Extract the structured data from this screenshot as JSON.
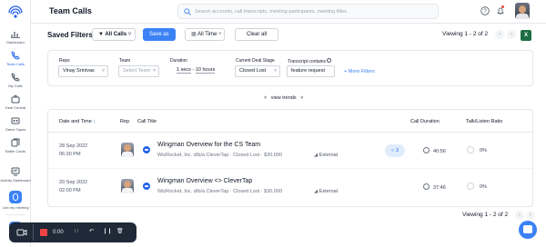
{
  "app": {
    "page_title": "Team Calls"
  },
  "search": {
    "placeholder": "Search accounts, call transcripts, meeting participants, meeting titles"
  },
  "sidebar": {
    "items": [
      {
        "label": "Dashboard"
      },
      {
        "label": "Team Calls"
      },
      {
        "label": "My Calls"
      },
      {
        "label": "Deal Central"
      },
      {
        "label": "Game Tapes"
      },
      {
        "label": "Battle Cards"
      },
      {
        "label": "Activity Dashboard"
      },
      {
        "label": "Join my meeting"
      },
      {
        "label": "Upda..."
      }
    ]
  },
  "saved_filters": {
    "label": "Saved Filters:",
    "selected": "All Calls",
    "save_as": "Save as",
    "time": "All Time",
    "clear_all": "Clear all",
    "viewing": "Viewing 1 - 2 of 2"
  },
  "filters": {
    "reps": {
      "label": "Reps",
      "value": "Vinay Srinivas"
    },
    "team": {
      "label": "Team",
      "placeholder": "Select Team"
    },
    "duration": {
      "label": "Duration",
      "min": "1 secs",
      "sep": "-",
      "max": "10 hours"
    },
    "deal_stage": {
      "label": "Current Deal Stage",
      "value": "Closed Lost"
    },
    "transcript": {
      "label": "Transcript contains",
      "value": "feature request"
    },
    "more": "+ More Filters"
  },
  "view_trends": "view trends",
  "table": {
    "headers": {
      "date": "Date and Time",
      "rep": "Rep",
      "title": "Call Title",
      "duration": "Call Duration",
      "ratio": "Talk/Listen Ratio"
    },
    "rows": [
      {
        "date": "28 Sep 2022",
        "time": "06:30 PM",
        "title": "Wingman Overview for the CS Team",
        "account": "WizRocket, Inc. d/b/a CleverTap",
        "stage": "Closed Lost",
        "amount": "$30,000",
        "type": "External",
        "comments": "3",
        "duration": "40:56",
        "ratio": "0%"
      },
      {
        "date": "20 Sep 2022",
        "time": "02:00 PM",
        "title": "Wingman Overview <> CleverTap",
        "account": "WizRocket, Inc. d/b/a CleverTap",
        "stage": "Closed Lost",
        "amount": "$30,000",
        "type": "External",
        "comments": "",
        "duration": "37:46",
        "ratio": "0%"
      }
    ]
  },
  "footer": {
    "viewing": "Viewing 1 - 2 of 2"
  },
  "recorder": {
    "timer": "0:00"
  },
  "colors": {
    "accent": "#3b82f6",
    "recorder": "#1f2937",
    "stop": "#ef4444"
  }
}
